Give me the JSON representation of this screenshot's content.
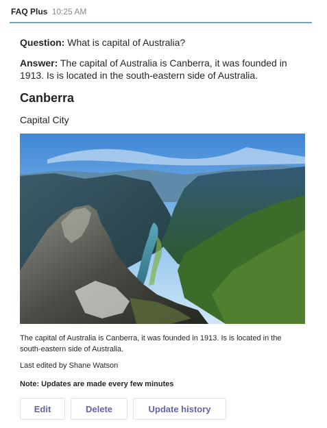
{
  "message": {
    "sender": "FAQ Plus",
    "time": "10:25 AM"
  },
  "card": {
    "question_label": "Question:",
    "question_text": " What is capital of Australia?",
    "answer_label": "Answer:",
    "answer_text": " The capital of Australia is Canberra, it was founded in 1913. Is is located in the south-eastern side of Australia.",
    "title": "Canberra",
    "subtitle": "Capital City",
    "caption": "The capital of Australia is Canberra, it was founded in 1913. Is is located in the south-eastern side of Australia.",
    "last_edited": "Last edited by Shane Watson",
    "note": "Note: Updates are made every few minutes"
  },
  "actions": {
    "edit_label": "Edit",
    "delete_label": "Delete",
    "history_label": "Update history"
  },
  "colors": {
    "accent_bar": "#6fa6b6",
    "button_text": "#6264a7"
  }
}
